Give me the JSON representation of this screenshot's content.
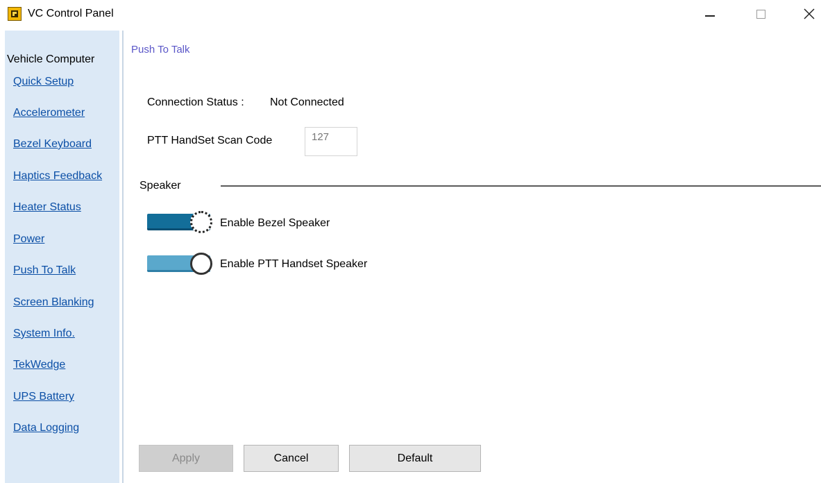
{
  "window": {
    "title": "VC Control Panel",
    "controls": {
      "minimize": "minimize-icon",
      "maximize": "maximize-icon",
      "close": "close-icon"
    }
  },
  "sidebar": {
    "header": "Vehicle Computer",
    "items": [
      {
        "label": "Quick Setup"
      },
      {
        "label": "Accelerometer"
      },
      {
        "label": "Bezel Keyboard"
      },
      {
        "label": "Haptics Feedback"
      },
      {
        "label": "Heater Status"
      },
      {
        "label": "Power"
      },
      {
        "label": "Push To Talk"
      },
      {
        "label": "Screen Blanking"
      },
      {
        "label": "System Info."
      },
      {
        "label": "TekWedge"
      },
      {
        "label": "UPS Battery"
      },
      {
        "label": "Data Logging"
      }
    ]
  },
  "main": {
    "section_title": "Push To Talk",
    "connection": {
      "label": "Connection Status :",
      "value": "Not Connected"
    },
    "scan_code": {
      "label": "PTT HandSet Scan Code",
      "value": "127"
    },
    "speaker": {
      "group_label": "Speaker",
      "toggles": [
        {
          "label": "Enable Bezel Speaker",
          "on": true
        },
        {
          "label": "Enable PTT Handset Speaker",
          "on": true
        }
      ]
    },
    "buttons": {
      "apply": "Apply",
      "cancel": "Cancel",
      "default": "Default"
    }
  },
  "colors": {
    "sidebar_bg": "#dce9f6",
    "link": "#0b4fa6",
    "section_title": "#5b57c8",
    "toggle_on_dark": "#136e99",
    "toggle_on_light": "#5aa8cc"
  }
}
